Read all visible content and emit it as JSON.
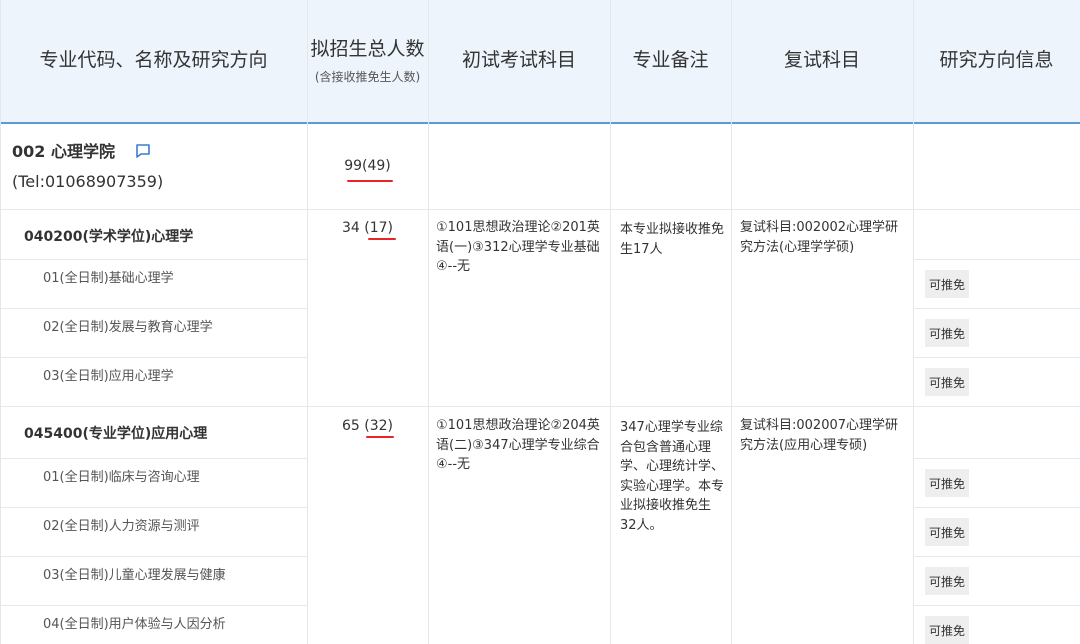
{
  "header": {
    "col1": "专业代码、名称及研究方向",
    "col2_main": "拟招生总人数",
    "col2_sub": "(含接收推免生人数)",
    "col3": "初试考试科目",
    "col4": "专业备注",
    "col5": "复试科目",
    "col6": "研究方向信息"
  },
  "school": {
    "name": "002 心理学院",
    "tel": "(Tel:01068907359)",
    "total": "99(49)",
    "comment_icon": "comment-icon"
  },
  "programs": [
    {
      "title": "040200(学术学位)心理学",
      "count": "34 (17)",
      "exam": "①101思想政治理论②201英语(一)③312心理学专业基础④--无",
      "note": "本专业拟接收推免生17人",
      "retest": "复试科目:002002心理学研究方法(心理学学硕)",
      "directions": [
        {
          "label": "01(全日制)基础心理学",
          "badge": "可推免"
        },
        {
          "label": "02(全日制)发展与教育心理学",
          "badge": "可推免"
        },
        {
          "label": "03(全日制)应用心理学",
          "badge": "可推免"
        }
      ]
    },
    {
      "title": "045400(专业学位)应用心理",
      "count": "65 (32)",
      "exam": "①101思想政治理论②204英语(二)③347心理学专业综合④--无",
      "note": "347心理学专业综合包含普通心理学、心理统计学、实验心理学。本专业拟接收推免生32人。",
      "retest": "复试科目:002007心理学研究方法(应用心理专硕)",
      "directions": [
        {
          "label": "01(全日制)临床与咨询心理",
          "badge": "可推免"
        },
        {
          "label": "02(全日制)人力资源与测评",
          "badge": "可推免"
        },
        {
          "label": "03(全日制)儿童心理发展与健康",
          "badge": "可推免"
        },
        {
          "label": "04(全日制)用户体验与人因分析",
          "badge": "可推免"
        }
      ]
    }
  ]
}
